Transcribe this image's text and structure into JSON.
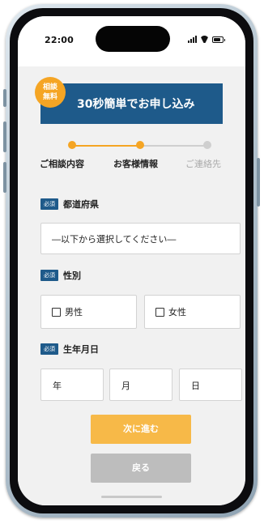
{
  "status_bar": {
    "time": "22:00"
  },
  "banner": {
    "badge_line1": "相談",
    "badge_line2": "無料",
    "title": "30秒簡単でお申し込み",
    "color": "#1e5a8a",
    "badge_color": "#f5a524"
  },
  "steps": {
    "items": [
      {
        "label": "ご相談内容",
        "state": "done"
      },
      {
        "label": "お客様情報",
        "state": "current"
      },
      {
        "label": "ご連絡先",
        "state": "pending"
      }
    ],
    "active_color": "#f5a524",
    "inactive_color": "#cfcfcf"
  },
  "form": {
    "required_tag": "必須",
    "prefecture": {
      "label": "都道府県",
      "value": "―以下から選択してください―"
    },
    "gender": {
      "label": "性別",
      "options": [
        "男性",
        "女性"
      ]
    },
    "birthdate": {
      "label": "生年月日",
      "year": "年",
      "month": "月",
      "day": "日"
    }
  },
  "buttons": {
    "next": "次に進む",
    "back": "戻る",
    "next_color": "#f7b948",
    "back_color": "#bdbdbd"
  }
}
